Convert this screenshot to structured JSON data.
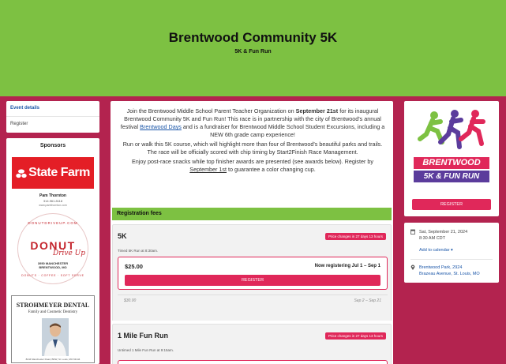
{
  "hero": {
    "title": "Brentwood Community 5K",
    "subtitle": "5K & Fun Run"
  },
  "nav": {
    "items": [
      {
        "label": "Event details"
      },
      {
        "label": "Register"
      }
    ]
  },
  "sponsors": {
    "title": "Sponsors",
    "statefarm": {
      "logo": "State Farm",
      "agent": "Pam Thornton",
      "phone": "314.961.8118",
      "web": "www.pamthornton.com"
    },
    "donut": {
      "ring_top": "DONUTDRIVEUP.COM",
      "word": "DONUT",
      "script": "Drive Up",
      "address_line1": "3950 MANCHESTER",
      "address_line2": "BRENTWOOD, MO",
      "ring_bottom": "DONUTS · COFFEE · SOFT SERVE"
    },
    "dental": {
      "name": "STROHMEYER DENTAL",
      "tag": "Family and Cosmetic Dentistry",
      "address": "8244 Manchester Road, BDW, St. Louis, MO 63144"
    }
  },
  "intro": {
    "p1_a": "Join the Brentwood Middle School Parent Teacher Organization on ",
    "p1_date": "September 21st",
    "p1_b": " for its inaugural Brentwood Community 5K and Fun Run! This race is in partnership with the city of Brentwood's annual festival ",
    "p1_link": "Brentwood Days",
    "p1_c": " and is a fundraiser for Brentwood Middle School Student Excursions, including a NEW 6th grade camp experience!",
    "p2": "Run or walk this 5K course, which will highlight more than four of Brentwood's beautiful parks and trails. The race will be officially scored with chip timing by Start2Finish Race Management.",
    "p3_a": "Enjoy post-race snacks while top finisher awards are presented (see awards below). Register by ",
    "p3_date": "September 1st",
    "p3_b": " to guarantee a color changing cup."
  },
  "registration": {
    "heading": "Registration fees",
    "races": [
      {
        "name": "5K",
        "badge": "Price changes in 27 days 13 hours",
        "desc": "Timed 5K Run at 8:30am.",
        "current_price": "$25.00",
        "current_window": "Now registering Jul 1 – Sep 1",
        "button": "REGISTER",
        "future_price": "$30.00",
        "future_window": "Sep 2 – Sep 21"
      },
      {
        "name": "1 Mile Fun Run",
        "badge": "Price changes in 27 days 13 hours",
        "desc": "Untimed 1 Mile Fun Run at 9:15am."
      }
    ]
  },
  "sidebar": {
    "logo_line1": "BRENTWOOD",
    "logo_line2": "5K & FUN RUN",
    "register_button": "REGISTER",
    "date": "Sat, September 21, 2024",
    "time": "8:30 AM CDT",
    "add_to_calendar": "Add to calendar ▾",
    "location_line1": "Brentwood Park, 2924",
    "location_line2": "Brazeau Avenue, St. Louis, MO"
  },
  "colors": {
    "green": "#7dc142",
    "maroon": "#b3234f",
    "pink": "#e0285a",
    "purple": "#5b3c9c",
    "link": "#1a56a8"
  }
}
